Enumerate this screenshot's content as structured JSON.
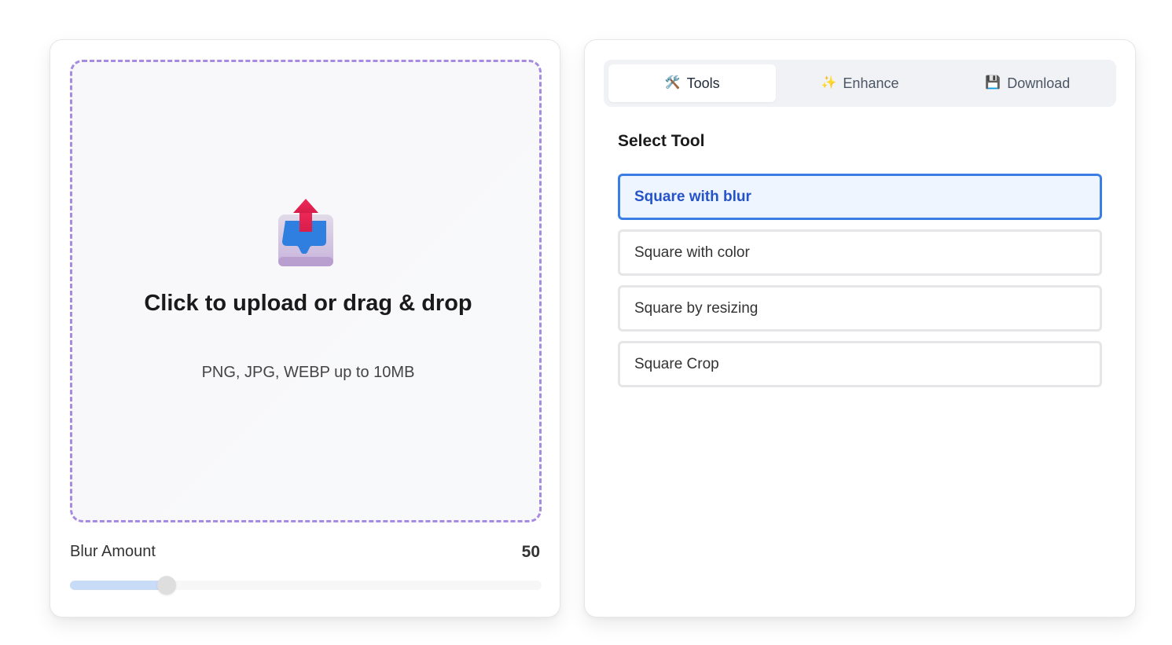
{
  "upload": {
    "title": "Click to upload or drag & drop",
    "subtitle": "PNG, JPG, WEBP up to 10MB",
    "icon": "upload-tray-icon"
  },
  "blur": {
    "label": "Blur Amount",
    "value": "50",
    "fraction": 0.205
  },
  "tabs": [
    {
      "label": "Tools",
      "icon": "🛠️",
      "icon_name": "tools-icon",
      "active": true
    },
    {
      "label": "Enhance",
      "icon": "✨",
      "icon_name": "sparkles-icon",
      "active": false
    },
    {
      "label": "Download",
      "icon": "💾",
      "icon_name": "floppy-disk-icon",
      "active": false
    }
  ],
  "tools_section": {
    "title": "Select Tool",
    "items": [
      {
        "label": "Square with blur",
        "selected": true
      },
      {
        "label": "Square with color",
        "selected": false
      },
      {
        "label": "Square by resizing",
        "selected": false
      },
      {
        "label": "Square Crop",
        "selected": false
      }
    ]
  },
  "colors": {
    "dropzone_border": "#a78be0",
    "selected_border": "#3b7ee3",
    "selected_text": "#2553c9",
    "slider_fill": "#c9dcf7"
  }
}
